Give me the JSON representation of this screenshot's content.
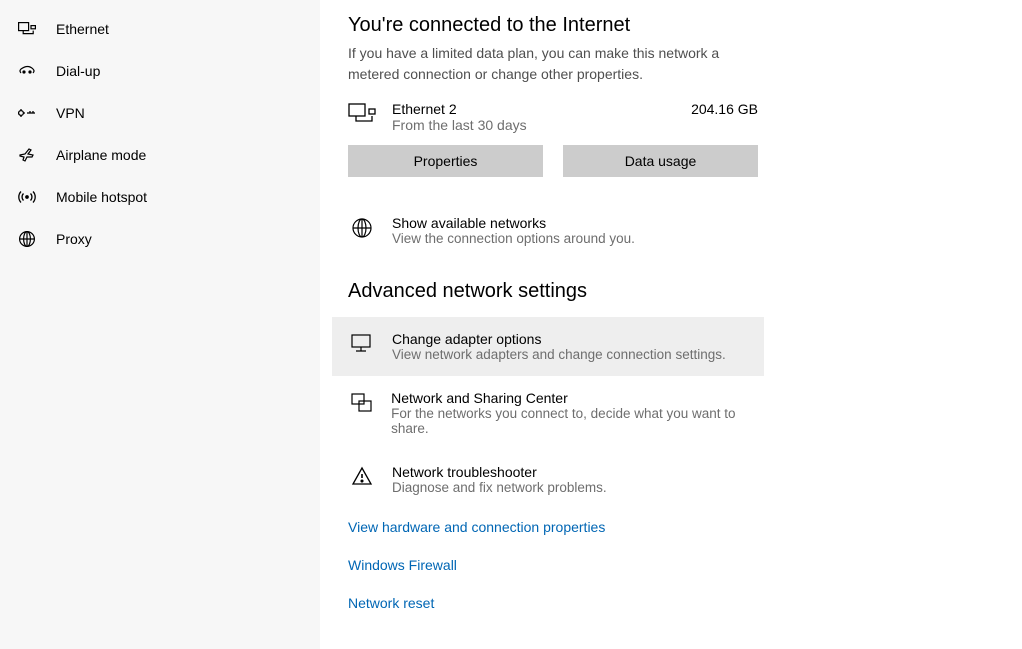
{
  "sidebar": {
    "items": [
      {
        "label": "Ethernet"
      },
      {
        "label": "Dial-up"
      },
      {
        "label": "VPN"
      },
      {
        "label": "Airplane mode"
      },
      {
        "label": "Mobile hotspot"
      },
      {
        "label": "Proxy"
      }
    ]
  },
  "main": {
    "headline": "You're connected to the Internet",
    "sub": "If you have a limited data plan, you can make this network a metered connection or change other properties.",
    "network": {
      "name": "Ethernet 2",
      "period": "From the last 30 days",
      "usage": "204.16 GB"
    },
    "buttons": {
      "properties": "Properties",
      "data_usage": "Data usage"
    },
    "available": {
      "title": "Show available networks",
      "desc": "View the connection options around you."
    },
    "advanced_title": "Advanced network settings",
    "adapter": {
      "title": "Change adapter options",
      "desc": "View network adapters and change connection settings."
    },
    "sharing": {
      "title": "Network and Sharing Center",
      "desc": "For the networks you connect to, decide what you want to share."
    },
    "troubleshoot": {
      "title": "Network troubleshooter",
      "desc": "Diagnose and fix network problems."
    },
    "links": {
      "hardware": "View hardware and connection properties",
      "firewall": "Windows Firewall",
      "reset": "Network reset"
    }
  }
}
